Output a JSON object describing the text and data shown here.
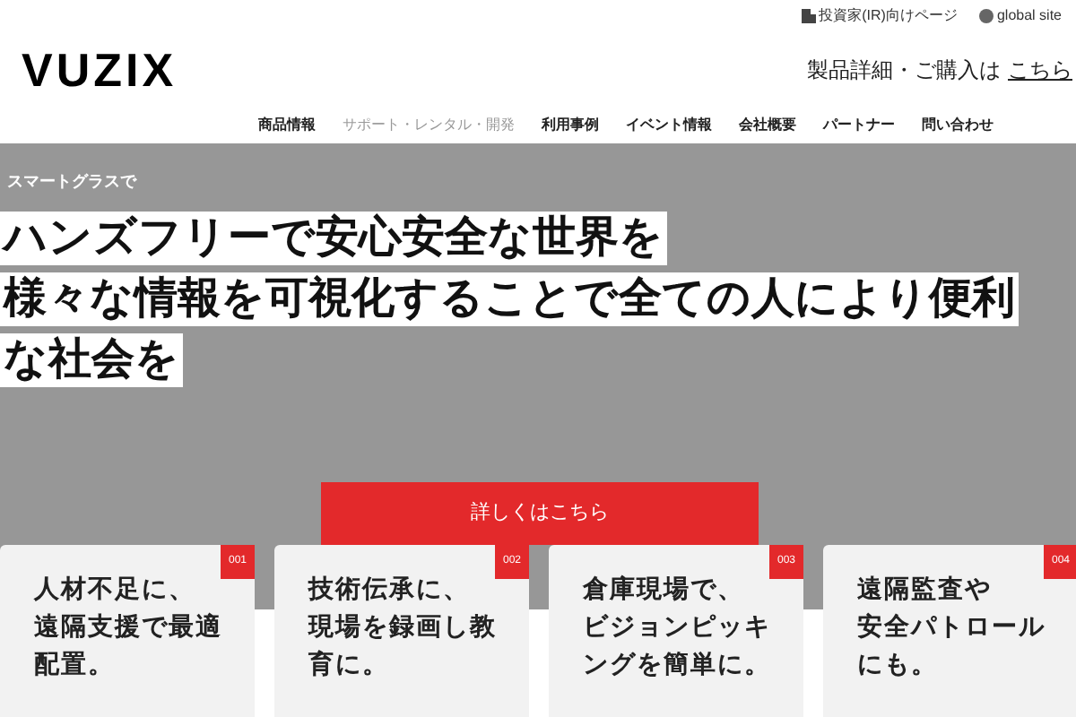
{
  "header": {
    "logo": "VUZIX",
    "ir_link": "投資家(IR)向けページ",
    "global_link": "global site",
    "purchase_text": "製品詳細・ご購入は",
    "purchase_link": "こちら"
  },
  "nav": [
    {
      "label": "商品情報",
      "selected": false
    },
    {
      "label": "サポート・レンタル・開発",
      "selected": true
    },
    {
      "label": "利用事例",
      "selected": false
    },
    {
      "label": "イベント情報",
      "selected": false
    },
    {
      "label": "会社概要",
      "selected": false
    },
    {
      "label": "パートナー",
      "selected": false
    },
    {
      "label": "問い合わせ",
      "selected": false
    }
  ],
  "hero": {
    "tag": "スマートグラスで",
    "headline_lines": [
      "ハンズフリーで安心安全な世界を",
      "様々な情報を可視化することで全ての人により便利",
      "な社会を"
    ],
    "button": "詳しくはこちら"
  },
  "cards": [
    {
      "number": "001",
      "title_lines": [
        "人材不足に、",
        "遠隔支援で最適",
        "配置。"
      ]
    },
    {
      "number": "002",
      "title_lines": [
        "技術伝承に、",
        "現場を録画し教",
        "育に。"
      ]
    },
    {
      "number": "003",
      "title_lines": [
        "倉庫現場で、",
        "ビジョンピッキ",
        "ングを簡単に。"
      ]
    },
    {
      "number": "004",
      "title_lines": [
        "遠隔監査や",
        "安全パトロール",
        "にも。"
      ]
    }
  ]
}
